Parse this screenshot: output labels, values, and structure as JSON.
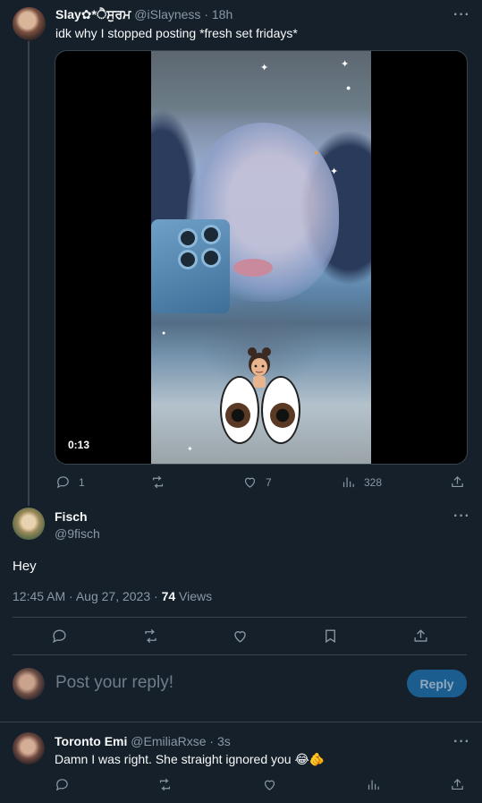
{
  "parent_tweet": {
    "name": "Slay✿*ੈਸੁਰਮ",
    "handle": "@iSlayness",
    "time": "· 18h",
    "text": "idk why I stopped posting *fresh set fridays*",
    "video_duration": "0:13",
    "replies": "1",
    "retweets": "",
    "likes": "7",
    "views": "328",
    "more_icon": "ellipsis-icon"
  },
  "main_tweet": {
    "name": "Fisch",
    "handle": "@9fisch",
    "text": "Hey",
    "timestamp": "12:45 AM · Aug 27, 2023 · ",
    "views_count": "74",
    "views_label": " Views"
  },
  "composer": {
    "placeholder": "Post your reply!",
    "reply_label": "Reply"
  },
  "reply_tweet": {
    "name": "Toronto Emi",
    "handle": "@EmiliaRxse",
    "time": "· 3s",
    "text": "Damn I was right. She straight ignored you 😂🫵"
  },
  "colors": {
    "background": "#15202b",
    "text": "#f7f9f9",
    "secondary": "#8b98a5",
    "accent": "#1d9bf0",
    "reply_button_disabled": "#1c5d8f"
  }
}
